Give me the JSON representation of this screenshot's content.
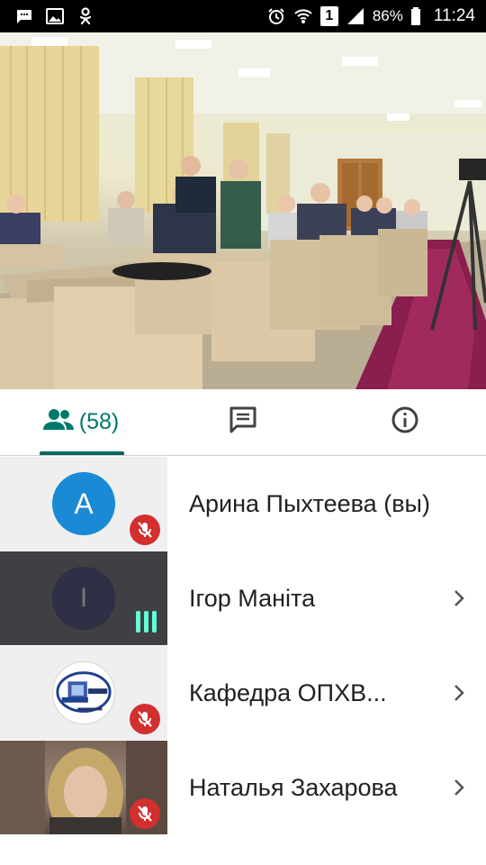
{
  "status_bar": {
    "battery": "86%",
    "sim": "1",
    "time": "11:24",
    "left_icons": [
      "chat-bubble-icon",
      "image-icon",
      "odnoklassniki-icon"
    ],
    "right_icons": [
      "alarm-icon",
      "wifi-icon",
      "sim-icon",
      "signal-icon",
      "battery-icon"
    ]
  },
  "tabs": {
    "participants_count": "(58)",
    "items": [
      "participants-tab",
      "chat-tab",
      "info-tab"
    ],
    "accent_color": "#00796b"
  },
  "participants": [
    {
      "name": "Арина Пыхтеева (вы)",
      "initial": "A",
      "avatar_color": "#1a8ad4",
      "muted": true
    },
    {
      "name": "Ігор Маніта",
      "initial": "I",
      "avatar_color": "#2f2f45",
      "speaking": true
    },
    {
      "name": "Кафедра ОПХВ...",
      "muted": true
    },
    {
      "name": "Наталья Захарова",
      "muted": true
    }
  ]
}
